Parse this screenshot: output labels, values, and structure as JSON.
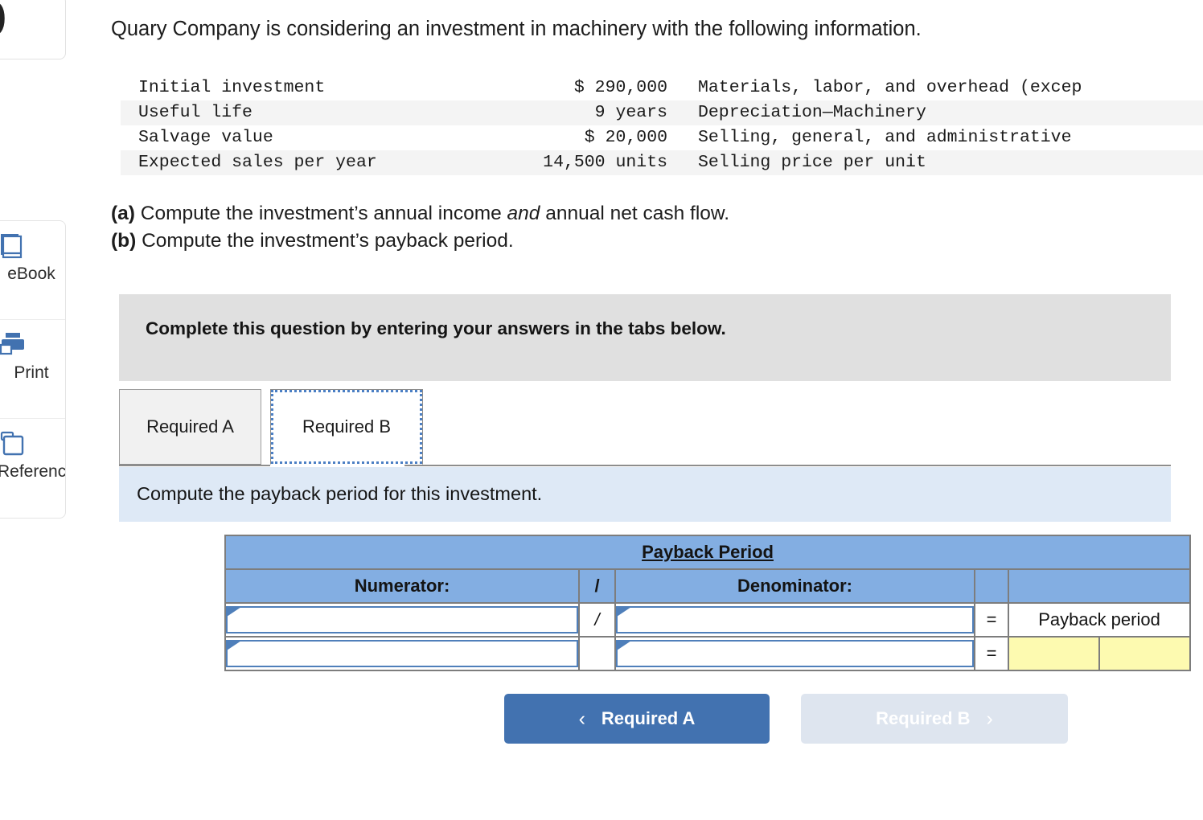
{
  "sidebar": {
    "logo_glyph": "b",
    "tools": [
      {
        "label": "eBook",
        "icon": "book-icon"
      },
      {
        "label": "Print",
        "icon": "printer-icon"
      },
      {
        "label": "References",
        "icon": "clipboard-icon"
      }
    ]
  },
  "question": {
    "title": "Quary Company is considering an investment in machinery with the following information.",
    "given_rows": [
      {
        "label": "Initial investment",
        "value": "$ 290,000",
        "label2": "Materials, labor, and overhead (excep"
      },
      {
        "label": "Useful life",
        "value": "9 years",
        "label2": "Depreciation—Machinery"
      },
      {
        "label": "Salvage value",
        "value": "$ 20,000",
        "label2": "Selling, general, and administrative"
      },
      {
        "label": "Expected sales per year",
        "value": "14,500 units",
        "label2": "Selling price per unit"
      }
    ],
    "requirement_a_prefix": "(a)",
    "requirement_a_part1": " Compute the investment’s annual income ",
    "requirement_a_italic": "and",
    "requirement_a_part2": " annual net cash flow.",
    "requirement_b_prefix": "(b)",
    "requirement_b_text": " Compute the investment’s payback period."
  },
  "banners": {
    "grey_instruction": "Complete this question by entering your answers in the tabs below.",
    "blue_requirement": "Compute the payback period for this investment."
  },
  "tabs": [
    {
      "label": "Required A",
      "active": false
    },
    {
      "label": "Required B",
      "active": true
    }
  ],
  "payback_table": {
    "title": "Payback Period",
    "headers": {
      "numerator": "Numerator:",
      "slash": "/",
      "denominator": "Denominator:",
      "eq_blank": "",
      "result_blank": ""
    },
    "rows": [
      {
        "numerator_value": "",
        "slash": "/",
        "denominator_value": "",
        "equals": "=",
        "result_label": "Payback period",
        "result_value": ""
      },
      {
        "numerator_value": "",
        "slash": "",
        "denominator_value": "",
        "equals": "=",
        "result_label": "",
        "result_value": ""
      }
    ]
  },
  "nav": {
    "prev_label": "Required A",
    "prev_chevron": "‹",
    "next_label": "Required B",
    "next_chevron": "›"
  },
  "colors": {
    "table_header_blue": "#83aee2",
    "banner_blue": "#dee9f6",
    "banner_grey": "#e0e0e0",
    "input_border_blue": "#4f7fba",
    "answer_yellow": "#fdfab0",
    "primary_button_blue": "#4272b0",
    "disabled_button": "#dee5ef"
  }
}
